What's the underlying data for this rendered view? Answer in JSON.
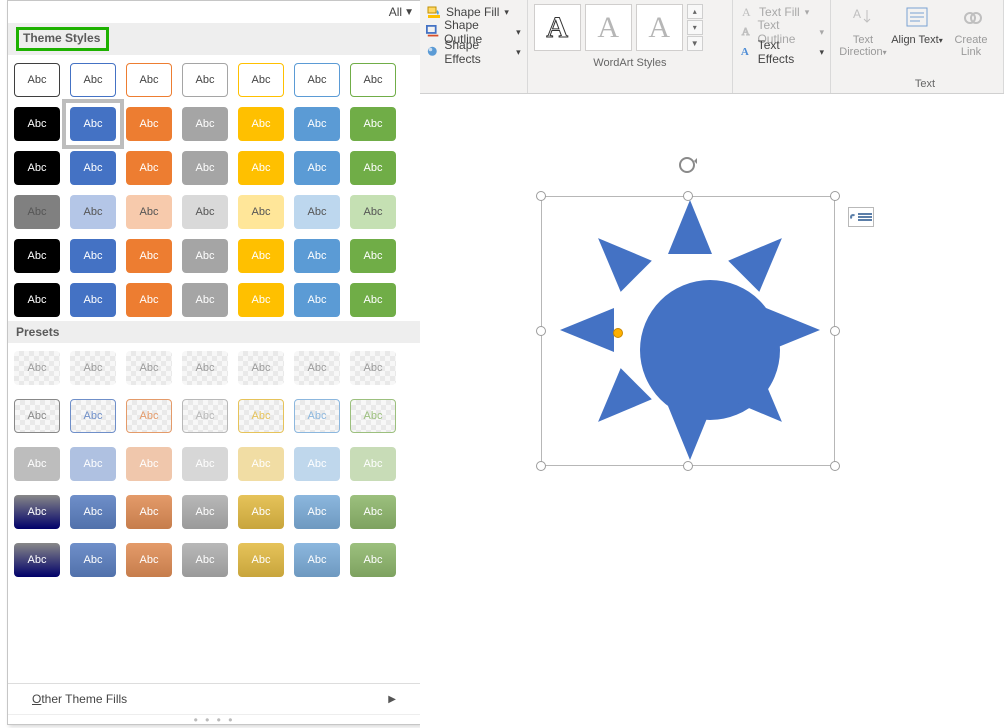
{
  "all_label": "All",
  "sections": {
    "theme_styles": "Theme Styles",
    "presets": "Presets",
    "other_fills": "Other Theme Fills"
  },
  "swatch_text": "Abc",
  "theme_rows": [
    {
      "type": "outline",
      "colors": [
        "#3f3f3f",
        "#4472c4",
        "#ed7d31",
        "#a5a5a5",
        "#ffc000",
        "#5b9bd5",
        "#70ad47"
      ]
    },
    {
      "type": "fill",
      "colors": [
        "#000000",
        "#4472c4",
        "#ed7d31",
        "#a5a5a5",
        "#ffc000",
        "#5b9bd5",
        "#70ad47"
      ],
      "selected": 1
    },
    {
      "type": "fill",
      "colors": [
        "#000000",
        "#4472c4",
        "#ed7d31",
        "#a5a5a5",
        "#ffc000",
        "#5b9bd5",
        "#70ad47"
      ]
    },
    {
      "type": "fill",
      "colors": [
        "#808080",
        "#b4c6e7",
        "#f7caac",
        "#d9d9d9",
        "#ffe699",
        "#bdd7ee",
        "#c5e0b3"
      ],
      "dark_text": true
    },
    {
      "type": "fill",
      "colors": [
        "#000000",
        "#4472c4",
        "#ed7d31",
        "#a5a5a5",
        "#ffc000",
        "#5b9bd5",
        "#70ad47"
      ]
    },
    {
      "type": "fill",
      "colors": [
        "#000000",
        "#4472c4",
        "#ed7d31",
        "#a5a5a5",
        "#ffc000",
        "#5b9bd5",
        "#70ad47"
      ]
    }
  ],
  "preset_rows": 5,
  "preset_cols": 7,
  "preset_tints": [
    "#888",
    "#6f8fc9",
    "#e49b6a",
    "#b8b8b8",
    "#e6c35a",
    "#8cb7de",
    "#9cc07e"
  ],
  "ribbon": {
    "shape_fill": "Shape Fill",
    "shape_outline": "Shape Outline",
    "shape_effects": "Shape Effects",
    "wordart_label": "WordArt Styles",
    "wordart_glyph": "A",
    "text_fill": "Text Fill",
    "text_outline": "Text Outline",
    "text_effects": "Text Effects",
    "text_direction": "Text Direction",
    "align_text": "Align Text",
    "create_link": "Create Link",
    "text_group": "Text"
  }
}
